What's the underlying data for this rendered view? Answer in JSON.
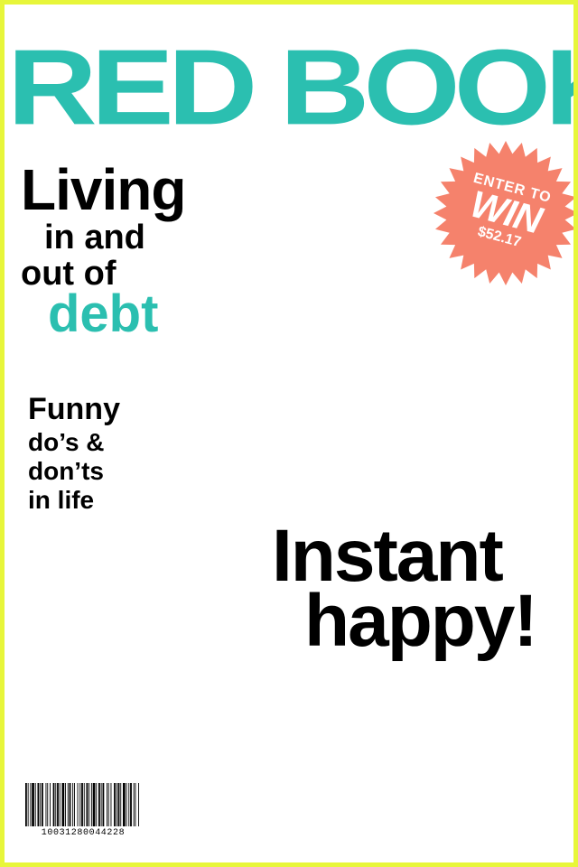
{
  "cover": {
    "masthead": "RED BOOKS",
    "border_color": "#e7f63a",
    "accent_color": "#2bbfb0",
    "badge_color": "#f5826c"
  },
  "stories": {
    "debt": {
      "line1": "Living",
      "line2": "in and",
      "line3": "out of",
      "line4": "debt"
    },
    "funny": {
      "line1": "Funny",
      "line2": "do’s &",
      "line3": "don’ts",
      "line4": "in life"
    },
    "happy": {
      "line1": "Instant",
      "line2": "happy!"
    }
  },
  "badge": {
    "line1": "ENTER TO",
    "line2": "WIN",
    "line3": "$52.17"
  },
  "barcode": {
    "number": "10031280044228"
  }
}
